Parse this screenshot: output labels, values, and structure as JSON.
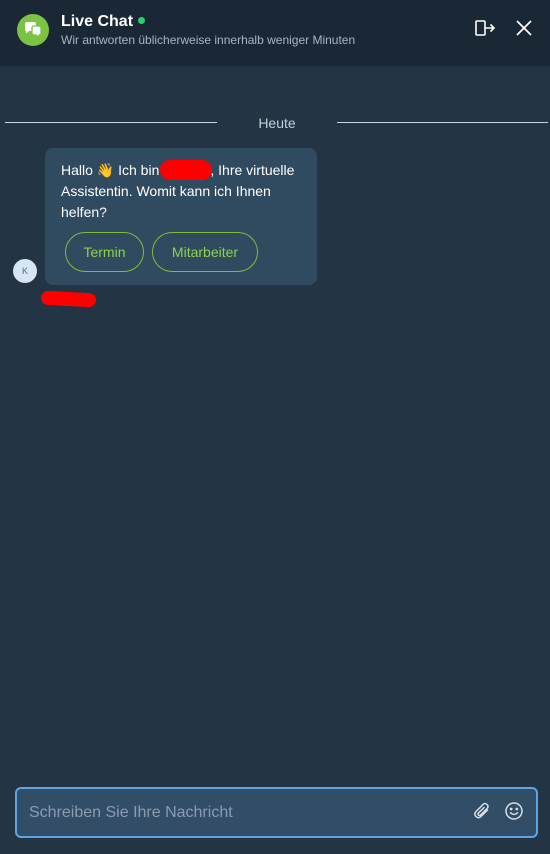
{
  "header": {
    "title": "Live Chat",
    "subtitle": "Wir antworten üblicherweise innerhalb weniger Minuten",
    "status_color": "#26d26a",
    "logo_icon": "chat-bubbles-icon",
    "expand_icon": "popout-icon",
    "close_icon": "close-icon"
  },
  "conversation": {
    "day_label": "Heute",
    "messages": [
      {
        "avatar_initial": "K",
        "text_before_name": "Hallo 👋 Ich bin",
        "text_after_name": ", Ihre virtuelle Assistentin. Womit kann ich Ihnen helfen?",
        "quick_replies": [
          "Termin",
          "Mitarbeiter"
        ]
      }
    ]
  },
  "composer": {
    "placeholder": "Schreiben Sie Ihre Nachricht",
    "value": "",
    "attach_icon": "paperclip-icon",
    "emoji_icon": "emoji-icon"
  },
  "colors": {
    "header_bg": "#1a2836",
    "body_bg": "#233444",
    "bubble_bg": "#304a60",
    "accent_green": "#7bbf3a",
    "focus_blue": "#5aa6e6"
  }
}
